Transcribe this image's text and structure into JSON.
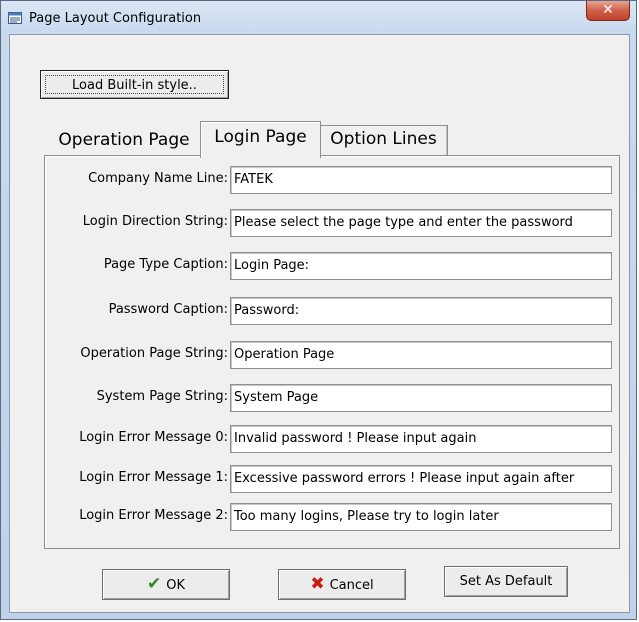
{
  "window": {
    "title": "Page Layout Configuration",
    "close_label": "✕"
  },
  "toolbar": {
    "load_label": "Load Built-in style.."
  },
  "tabs": [
    {
      "label": "Operation Page",
      "active": false
    },
    {
      "label": "Login Page",
      "active": true
    },
    {
      "label": "Option Lines",
      "active": false
    }
  ],
  "fields": [
    {
      "label": "Company Name Line:",
      "value": "FATEK"
    },
    {
      "label": "Login Direction String:",
      "value": "Please select the page type and enter the password"
    },
    {
      "label": "Page Type Caption:",
      "value": "Login Page:"
    },
    {
      "label": "Password Caption:",
      "value": "Password:"
    },
    {
      "label": "Operation Page String:",
      "value": "Operation Page"
    },
    {
      "label": "System Page String:",
      "value": "System Page"
    },
    {
      "label": "Login Error Message 0:",
      "value": "Invalid password ! Please input again"
    },
    {
      "label": "Login Error Message 1:",
      "value": "Excessive password errors ! Please input again after"
    },
    {
      "label": "Login Error Message 2:",
      "value": "Too many logins, Please try to login later"
    }
  ],
  "buttons": {
    "ok_label": "OK",
    "cancel_label": "Cancel",
    "default_label": "Set As Default"
  },
  "icons": {
    "ok": "check-icon",
    "cancel": "x-icon",
    "title": "window-app-icon"
  },
  "colors": {
    "ok_check": "#2e8b20",
    "cancel_x": "#c41d10",
    "close_button": "#c0402a"
  }
}
